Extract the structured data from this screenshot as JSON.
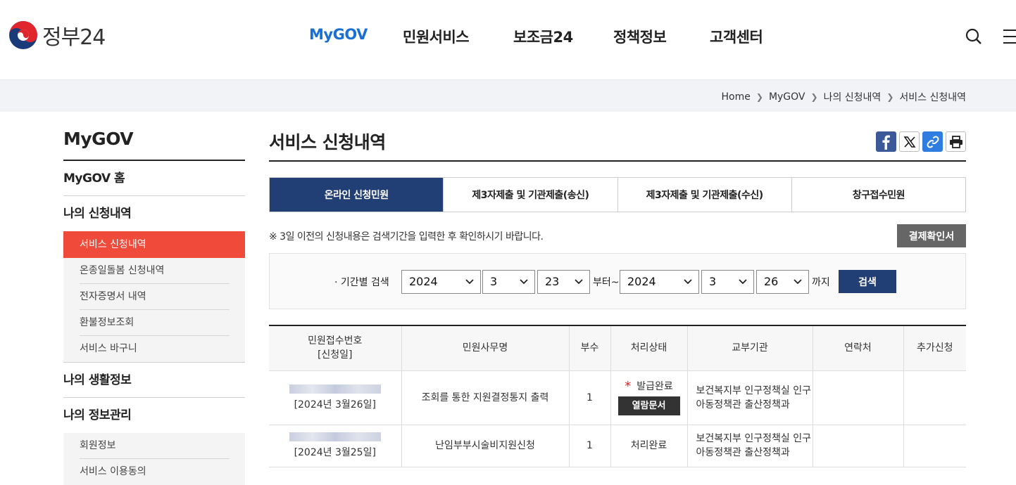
{
  "header": {
    "logo_text": "정부24",
    "nav": [
      "MyGOV",
      "민원서비스",
      "보조금24",
      "정책정보",
      "고객센터"
    ]
  },
  "breadcrumb": [
    "Home",
    "MyGOV",
    "나의 신청내역",
    "서비스 신청내역"
  ],
  "sidebar": {
    "title": "MyGOV",
    "home": "MyGOV 홈",
    "section1": "나의 신청내역",
    "section1_items": [
      "서비스 신청내역",
      "온종일돌봄 신청내역",
      "전자증명서 내역",
      "환불정보조회",
      "서비스 바구니"
    ],
    "section2": "나의 생활정보",
    "section3": "나의 정보관리",
    "section3_items": [
      "회원정보",
      "서비스 이용동의"
    ]
  },
  "main": {
    "title": "서비스 신청내역",
    "tabs": [
      "온라인 신청민원",
      "제3자제출 및 기관제출(송신)",
      "제3자제출 및 기관제출(수신)",
      "창구접수민원"
    ],
    "notice": "※ 3일 이전의 신청내용은 검색기간을 입력한 후 확인하시기 바랍니다.",
    "confirm_button": "결제확인서",
    "search": {
      "label": "· 기간별 검색",
      "from_year": "2024",
      "from_month": "3",
      "from_day": "23",
      "from_text": "부터~",
      "to_year": "2024",
      "to_month": "3",
      "to_day": "26",
      "to_text": "까지",
      "button": "검색"
    },
    "table": {
      "headers": [
        "민원접수번호",
        "[신청일]",
        "민원사무명",
        "부수",
        "처리상태",
        "교부기관",
        "연락처",
        "추가신청"
      ],
      "rows": [
        {
          "date": "[2024년 3월26일]",
          "name": "조회를 통한 지원결정통지 출력",
          "copies": "1",
          "status": "발급완료",
          "view_button": "열람문서",
          "agency": "보건복지부 인구정책실 인구아동정책관 출산정책과"
        },
        {
          "date": "[2024년 3월25일]",
          "name": "난임부부시술비지원신청",
          "copies": "1",
          "status": "처리완료",
          "agency": "보건복지부 인구정책실 인구아동정책관 출산정책과"
        }
      ]
    }
  },
  "colors": {
    "accent_blue": "#1a6fd4",
    "navy": "#223f75",
    "active_red": "#f04a3a"
  }
}
